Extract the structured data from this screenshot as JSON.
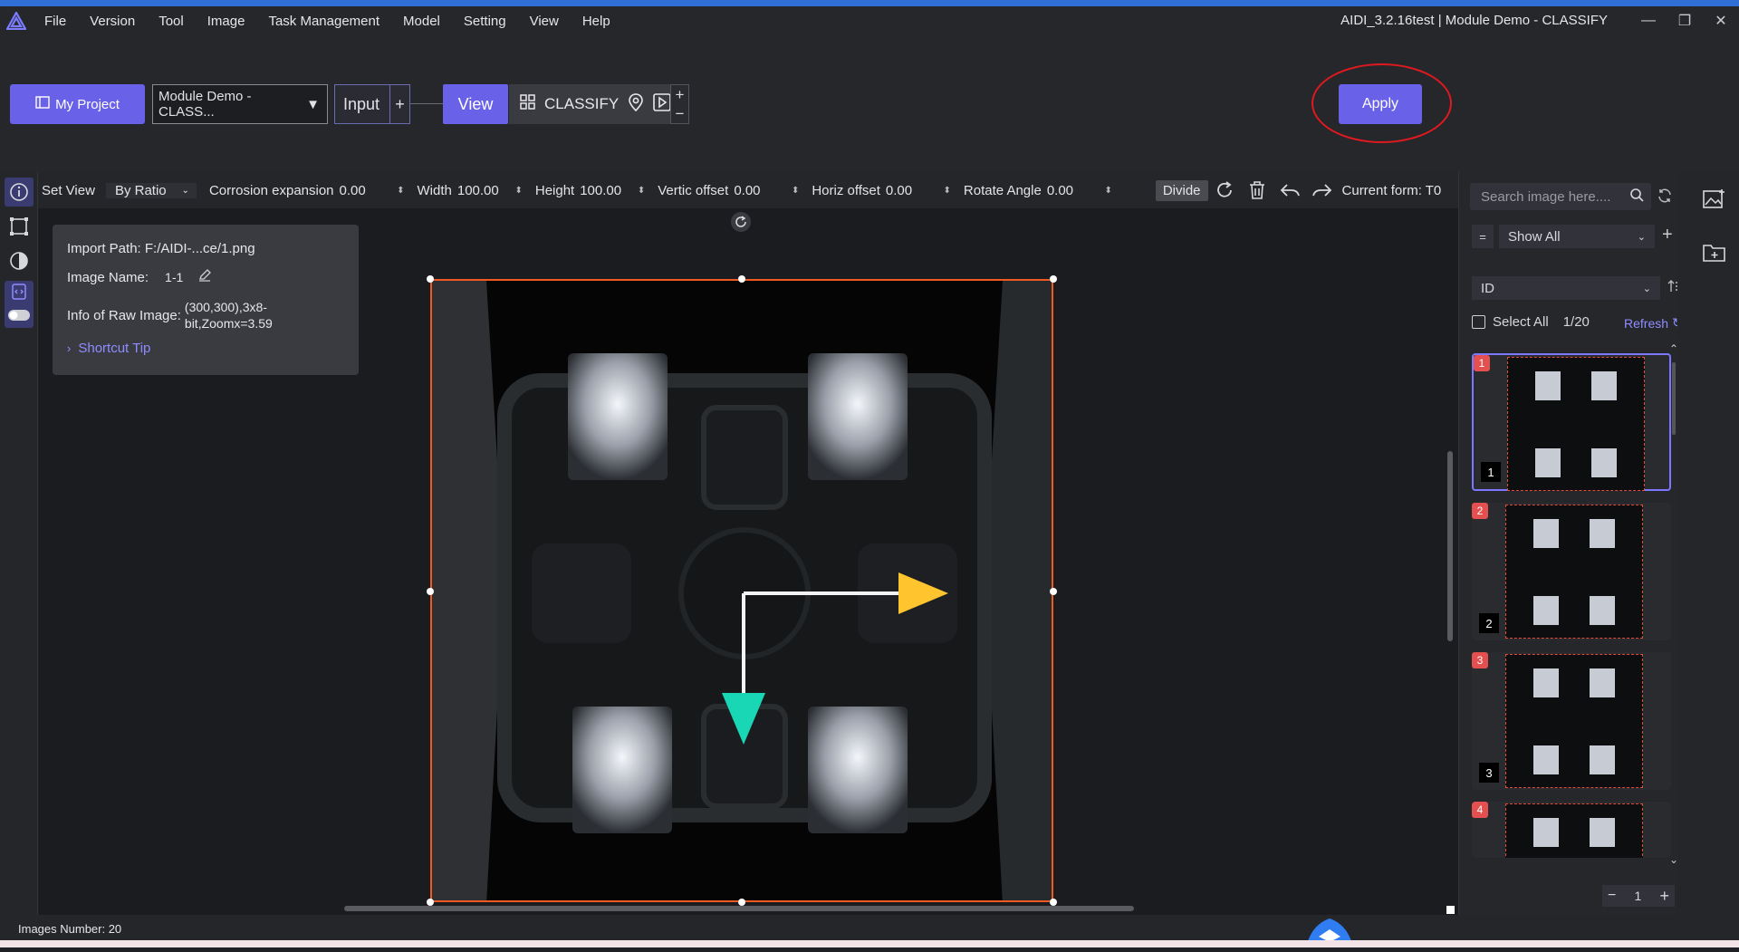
{
  "app": {
    "window_title": "AIDI_3.2.16test | Module Demo - CLASSIFY",
    "menu": [
      "File",
      "Version",
      "Tool",
      "Image",
      "Task Management",
      "Model",
      "Setting",
      "View",
      "Help"
    ]
  },
  "toolbar": {
    "my_project": "My Project",
    "project_select": "Module Demo - CLASS...",
    "input_label": "Input",
    "view_label": "View",
    "classify_label": "CLASSIFY",
    "apply_label": "Apply"
  },
  "view_toolbar": {
    "set_view": "Set View",
    "mode": "By Ratio",
    "corrosion_label": "Corrosion expansion",
    "corrosion_value": "0.00",
    "width_label": "Width",
    "width_value": "100.00",
    "height_label": "Height",
    "height_value": "100.00",
    "vertic_label": "Vertic offset",
    "vertic_value": "0.00",
    "horiz_label": "Horiz offset",
    "horiz_value": "0.00",
    "rotate_label": "Rotate Angle",
    "rotate_value": "0.00",
    "divide_label": "Divide",
    "current_form": "Current form: T0"
  },
  "info": {
    "import_path": "Import Path: F:/AIDI-...ce/1.png",
    "image_name_label": "Image Name:",
    "image_name_value": "1-1",
    "raw_label": "Info of Raw Image:",
    "raw_value_1": "(300,300),3x8-",
    "raw_value_2": "bit,Zoomx=3.59",
    "shortcut_tip": "Shortcut Tip"
  },
  "right_panel": {
    "search_placeholder": "Search image here....",
    "filter_eq": "=",
    "show_all": "Show All",
    "sort_by": "ID",
    "select_all": "Select All",
    "count": "1/20",
    "refresh": "Refresh",
    "thumbnails": [
      {
        "badge": "1",
        "num": "1"
      },
      {
        "badge": "2",
        "num": "2"
      },
      {
        "badge": "3",
        "num": "3"
      },
      {
        "badge": "4",
        "num": ""
      }
    ],
    "page_value": "1"
  },
  "status": {
    "images_number": "Images Number: 20"
  },
  "colors": {
    "accent": "#6962e8",
    "roi": "#ef5a23",
    "annotation": "#e0191f",
    "arrow_x": "#ffc42e",
    "arrow_y": "#19d6b5"
  }
}
